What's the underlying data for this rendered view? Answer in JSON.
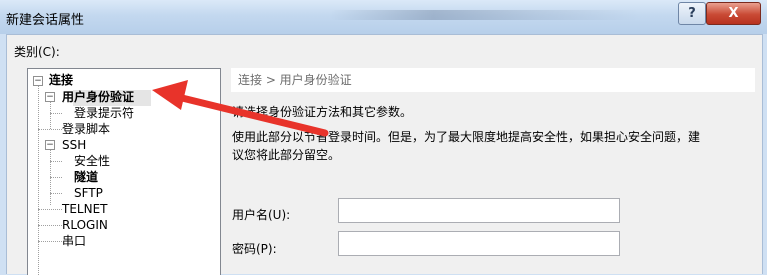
{
  "window": {
    "title": "新建会话属性",
    "help_symbol": "?",
    "close_symbol": "X"
  },
  "category_label": "类别(C):",
  "tree": {
    "items": [
      {
        "label": "连接",
        "bold": true,
        "expander": "−"
      },
      {
        "label": "用户身份验证",
        "bold": true,
        "expander": "−",
        "selected": true
      },
      {
        "label": "登录提示符",
        "bold": false
      },
      {
        "label": "登录脚本",
        "bold": false
      },
      {
        "label": "SSH",
        "bold": false,
        "expander": "−"
      },
      {
        "label": "安全性",
        "bold": false
      },
      {
        "label": "隧道",
        "bold": true
      },
      {
        "label": "SFTP",
        "bold": false
      },
      {
        "label": "TELNET",
        "bold": false
      },
      {
        "label": "RLOGIN",
        "bold": false
      },
      {
        "label": "串口",
        "bold": false
      }
    ]
  },
  "content": {
    "breadcrumb": "连接 > 用户身份验证",
    "desc_line1": "请选择身份验证方法和其它参数。",
    "desc_line2": "使用此部分以节省登录时间。但是，为了最大限度地提高安全性，如果担心安全问题，建",
    "desc_line3": "议您将此部分留空。",
    "username_label": "用户名(U):",
    "username_value": "",
    "password_label": "密码(P):",
    "password_value": ""
  },
  "annotation": {
    "arrow_color": "#e8332a"
  }
}
